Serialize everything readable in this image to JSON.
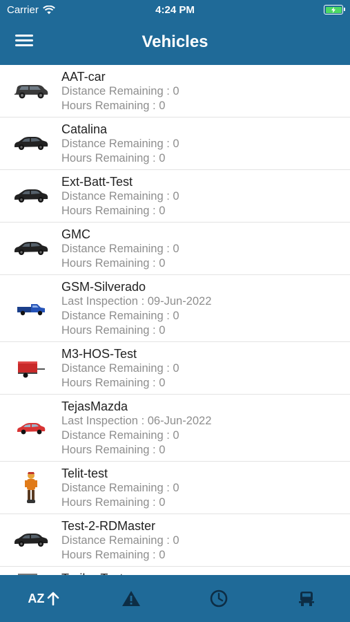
{
  "status_bar": {
    "carrier": "Carrier",
    "time": "4:24 PM"
  },
  "header": {
    "title": "Vehicles"
  },
  "vehicles": [
    {
      "name": "AAT-car",
      "icon": "dark-suv-icon",
      "lines": [
        "Distance Remaining : 0",
        "Hours Remaining : 0"
      ]
    },
    {
      "name": "Catalina",
      "icon": "dark-car-icon",
      "lines": [
        "Distance Remaining : 0",
        "Hours Remaining : 0"
      ]
    },
    {
      "name": "Ext-Batt-Test",
      "icon": "dark-car-icon",
      "lines": [
        "Distance Remaining : 0",
        "Hours Remaining : 0"
      ]
    },
    {
      "name": "GMC",
      "icon": "dark-car-icon",
      "lines": [
        "Distance Remaining : 0",
        "Hours Remaining : 0"
      ]
    },
    {
      "name": "GSM-Silverado",
      "icon": "blue-pickup-truck-icon",
      "lines": [
        "Last Inspection : 09-Jun-2022",
        "Distance Remaining : 0",
        "Hours Remaining : 0"
      ]
    },
    {
      "name": "M3-HOS-Test",
      "icon": "red-trailer-icon",
      "lines": [
        "Distance Remaining : 0",
        "Hours Remaining : 0"
      ]
    },
    {
      "name": "TejasMazda",
      "icon": "red-car-icon",
      "lines": [
        "Last Inspection : 06-Jun-2022",
        "Distance Remaining : 0",
        "Hours Remaining : 0"
      ]
    },
    {
      "name": "Telit-test",
      "icon": "person-figure-icon",
      "lines": [
        "Distance Remaining : 0",
        "Hours Remaining : 0"
      ]
    },
    {
      "name": "Test-2-RDMaster",
      "icon": "dark-car-icon",
      "lines": [
        "Distance Remaining : 0",
        "Hours Remaining : 0"
      ]
    },
    {
      "name": "Trailer-Test",
      "icon": "trailer-icon",
      "lines": []
    }
  ],
  "tab_bar": {
    "sort_label": "AZ",
    "tabs": [
      "sort-az-ascending",
      "alert-triangle-icon",
      "clock-icon",
      "vehicle-icon"
    ]
  },
  "colors": {
    "primary": "#1f6a98",
    "tab_icon": "#0d2d45",
    "detail_text": "#8e8e8e",
    "battery": "#4cd964"
  }
}
